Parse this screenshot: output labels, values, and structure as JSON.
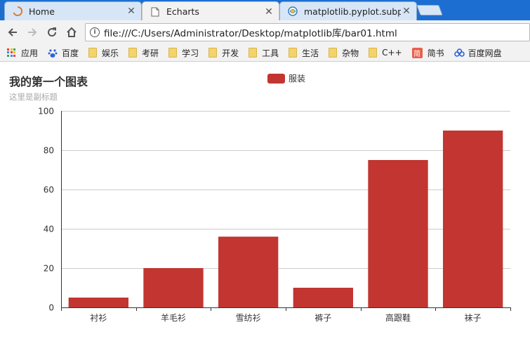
{
  "browser": {
    "tabs": [
      {
        "title": "Home",
        "icon": "loading-spinner-icon"
      },
      {
        "title": "Echarts",
        "icon": "page-icon"
      },
      {
        "title": "matplotlib.pyplot.subp",
        "icon": "python-icon"
      }
    ],
    "close_glyph": "✕",
    "address": "file:///C:/Users/Administrator/Desktop/matplotlib库/bar01.html",
    "bookmarks": [
      {
        "label": "应用",
        "icon": "apps-grid-icon"
      },
      {
        "label": "百度",
        "icon": "baidu-paw-icon"
      },
      {
        "label": "娱乐",
        "icon": "folder-icon"
      },
      {
        "label": "考研",
        "icon": "folder-icon"
      },
      {
        "label": "学习",
        "icon": "folder-icon"
      },
      {
        "label": "开发",
        "icon": "folder-icon"
      },
      {
        "label": "工具",
        "icon": "folder-icon"
      },
      {
        "label": "生活",
        "icon": "folder-icon"
      },
      {
        "label": "杂物",
        "icon": "folder-icon"
      },
      {
        "label": "C++",
        "icon": "folder-icon"
      },
      {
        "label": "简书",
        "icon": "jianshu-icon"
      },
      {
        "label": "百度网盘",
        "icon": "baidu-netdisk-icon"
      }
    ]
  },
  "colors": {
    "bar": "#c23531",
    "axis": "#333333",
    "grid": "#cccccc",
    "tabstrip": "#1c6fd1"
  },
  "chart_data": {
    "type": "bar",
    "title": "我的第一个图表",
    "subtitle": "这里是副标题",
    "categories": [
      "衬衫",
      "羊毛衫",
      "雪纺衫",
      "裤子",
      "高跟鞋",
      "袜子"
    ],
    "series": [
      {
        "name": "服装",
        "values": [
          5,
          20,
          36,
          10,
          75,
          90
        ]
      }
    ],
    "ylim": [
      0,
      100
    ],
    "yticks": [
      0,
      20,
      40,
      60,
      80,
      100
    ],
    "grid": true,
    "legend_position": "top-center"
  }
}
